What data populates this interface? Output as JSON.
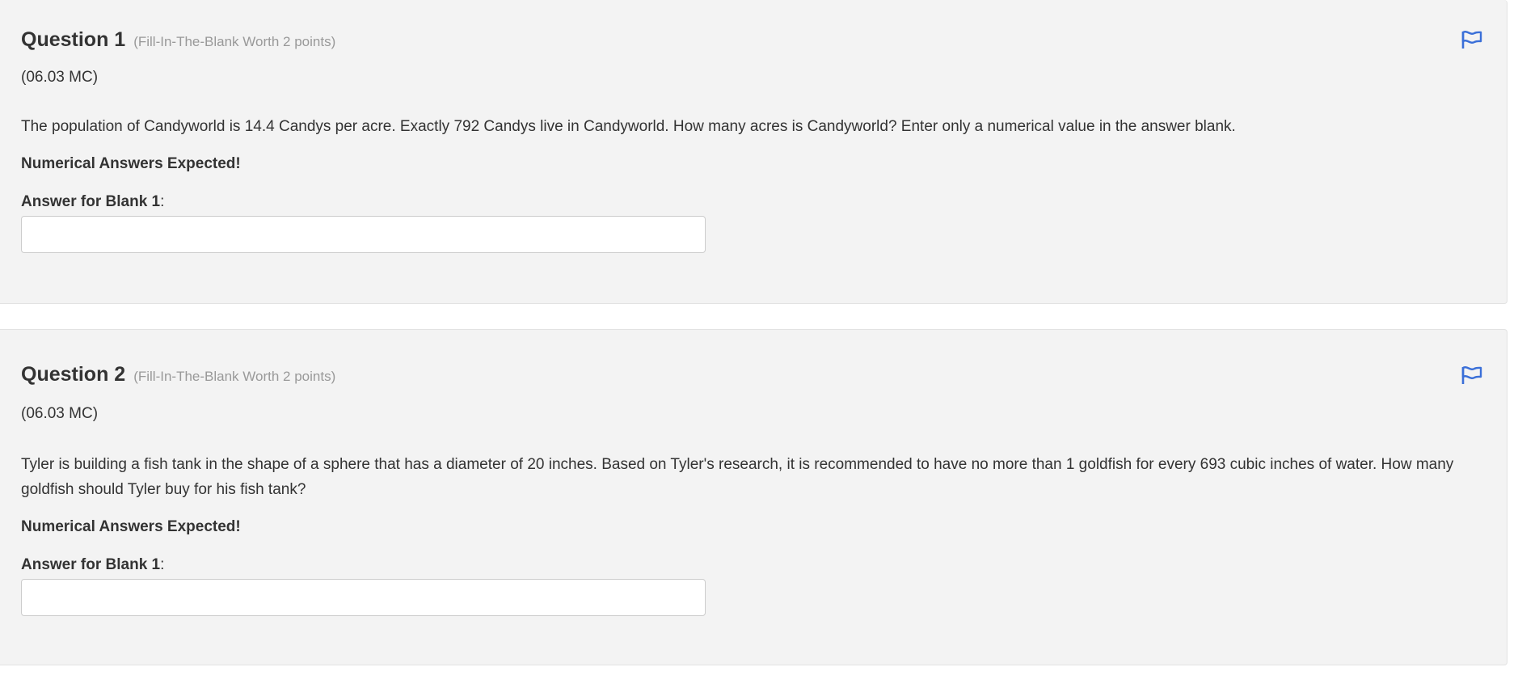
{
  "questions": [
    {
      "title": "Question 1",
      "meta": "(Fill-In-The-Blank Worth 2 points)",
      "code": "(06.03 MC)",
      "text": "The population of Candyworld is 14.4 Candys per acre. Exactly 792 Candys live in Candyworld. How many acres is Candyworld? Enter only a numerical value in the answer blank.",
      "note": "Numerical Answers Expected!",
      "answer_label": "Answer for Blank 1",
      "answer_label_suffix": ":",
      "answer_value": "",
      "flag_icon": "flag-icon"
    },
    {
      "title": "Question 2",
      "meta": "(Fill-In-The-Blank Worth 2 points)",
      "code": "(06.03 MC)",
      "text": "Tyler is building a fish tank in the shape of a sphere that has a diameter of 20 inches. Based on Tyler's research, it is recommended to have no more than 1 goldfish for every 693 cubic inches of water. How many goldfish should Tyler buy for his fish tank?",
      "note": "Numerical Answers Expected!",
      "answer_label": "Answer for Blank 1",
      "answer_label_suffix": ":",
      "answer_value": "",
      "flag_icon": "flag-icon"
    }
  ],
  "colors": {
    "card_bg": "#f3f3f3",
    "flag": "#3a6fd8",
    "meta_text": "#999999"
  }
}
